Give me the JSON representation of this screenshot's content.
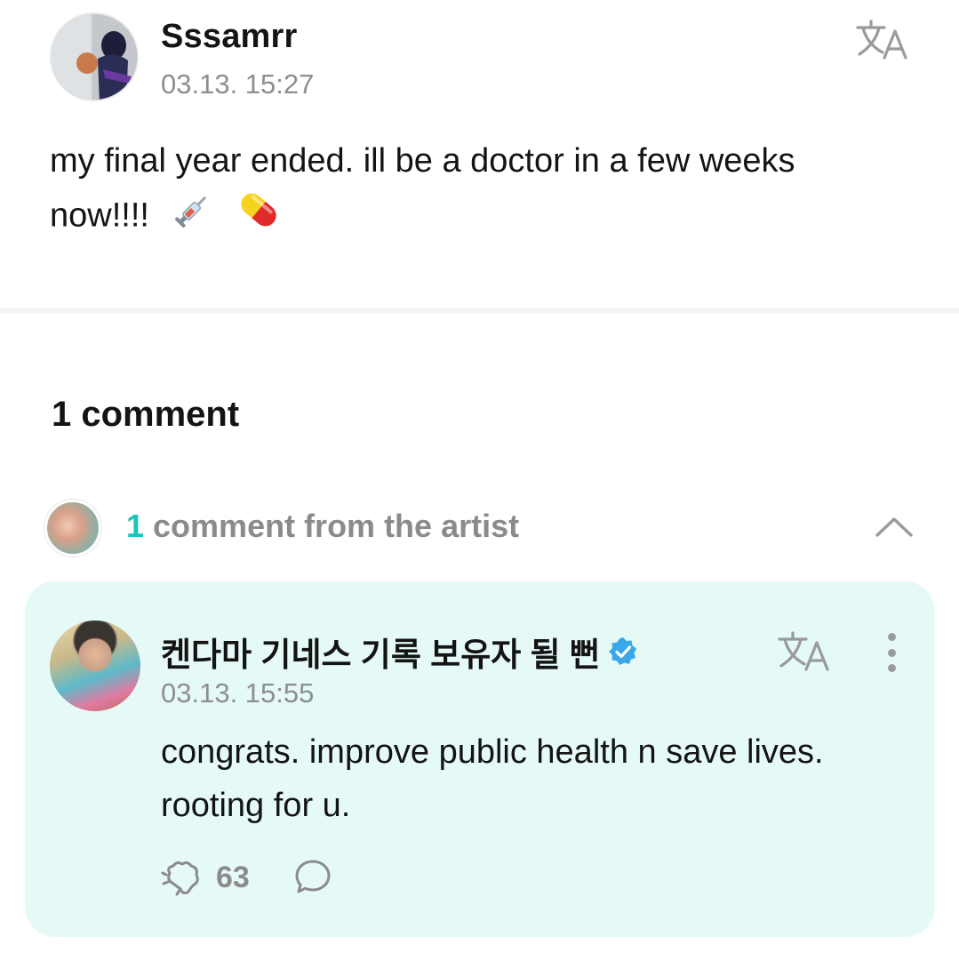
{
  "post": {
    "author": "Sssamrr",
    "timestamp": "03.13. 15:27",
    "body_text": "my final year ended. ill be a doctor in a few weeks now!!!!",
    "emojis": [
      "syringe-emoji",
      "pill-emoji"
    ],
    "translate_icon": "translate-icon"
  },
  "comments": {
    "count_label": "1 comment",
    "artist_section": {
      "count": "1",
      "label": "comment from the artist",
      "toggle_icon": "chevron-up-icon"
    }
  },
  "artist_comment": {
    "author": "켄다마 기네스 기록 보유자 될 뻔",
    "verified_icon": "verified-badge-icon",
    "timestamp": "03.13. 15:55",
    "body_text": "congrats. improve public health n save lives. rooting for u.",
    "like_count": "63",
    "like_icon": "like-icon",
    "reply_icon": "reply-icon",
    "more_icon": "more-vertical-icon"
  },
  "colors": {
    "accent_teal": "#19c4bb",
    "artist_card_bg": "#e5faf7",
    "verified_blue": "#3aa8e8",
    "secondary_text": "#8e8e8e"
  }
}
